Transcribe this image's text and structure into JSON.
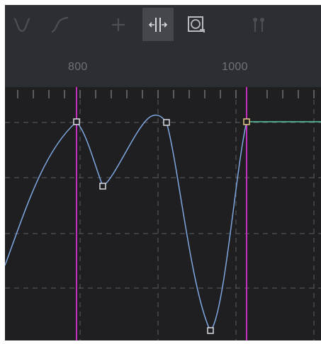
{
  "toolbar": {
    "tools": [
      {
        "name": "smooth-tangent-icon",
        "active": false,
        "enabled": false
      },
      {
        "name": "linear-curve-icon",
        "active": false,
        "enabled": false
      },
      {
        "name": "add-key-icon",
        "active": false,
        "enabled": false
      },
      {
        "name": "split-tangent-icon",
        "active": true,
        "enabled": true
      },
      {
        "name": "zoom-frame-icon",
        "active": false,
        "enabled": true
      },
      {
        "name": "snap-keys-icon",
        "active": false,
        "enabled": false
      }
    ]
  },
  "ruler": {
    "labels": [
      "800",
      "1000"
    ]
  },
  "colors": {
    "background": "#1f1f22",
    "toolbar": "#2b2e32",
    "curve": "#7fa8e0",
    "playhead": "#c52fbe",
    "hold_line": "#58c8a8",
    "grid": "#5a5d63"
  }
}
